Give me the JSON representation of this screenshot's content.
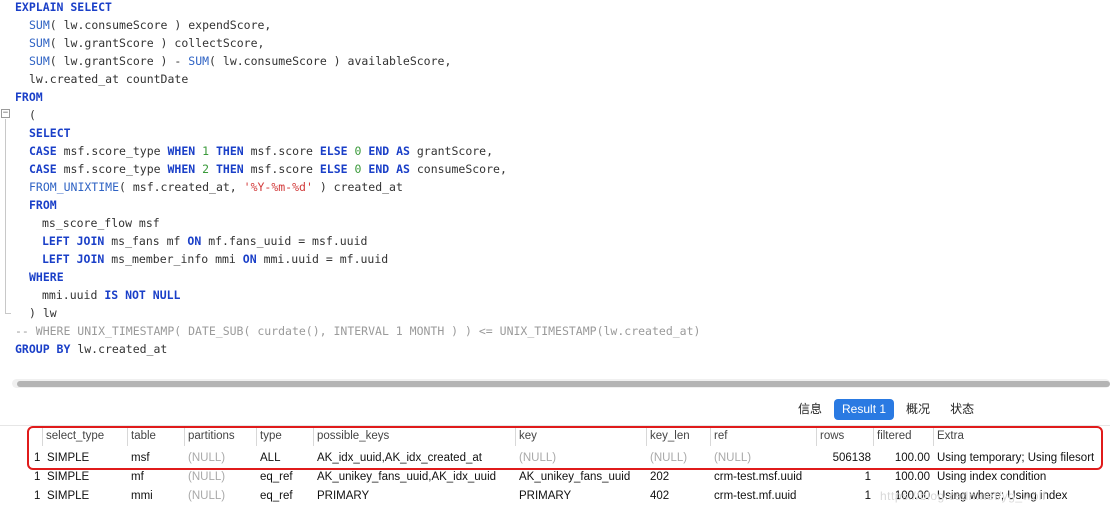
{
  "sql": {
    "l1": "EXPLAIN SELECT",
    "sum": "SUM",
    "l2_a": "( lw.consumeScore ) expendScore,",
    "l3_a": "( lw.grantScore ) collectScore,",
    "l4_a": "( lw.grantScore ) - ",
    "l4_b": "( lw.consumeScore ) availableScore,",
    "l5": "lw.created_at countDate",
    "from": "FROM",
    "paren_open": "(",
    "select": "SELECT",
    "case": "CASE",
    "l8_a": " msf.score_type ",
    "when": "WHEN",
    "then": "THEN",
    "else": "ELSE",
    "end_as": "END AS",
    "l8_num": "1",
    "l9_num": "2",
    "zero": "0",
    "l8_b": " msf.score ",
    "l8_c": " grantScore,",
    "l9_c": " consumeScore,",
    "from_unixtime": "FROM_UNIXTIME",
    "l10_a": "( msf.created_at, ",
    "l10_str": "'%Y-%m-%d'",
    "l10_b": " ) created_at",
    "l12": "ms_score_flow msf",
    "left_join": "LEFT JOIN",
    "l13_a": " ms_fans mf ",
    "on": "ON",
    "l13_b": " mf.fans_uuid = msf.uuid",
    "l14_a": " ms_member_info mmi ",
    "l14_b": " mmi.uuid = mf.uuid",
    "where": "WHERE",
    "l16_a": "mmi.uuid ",
    "is_not_null": "IS NOT NULL",
    "l17": ") lw",
    "comment": "-- WHERE UNIX_TIMESTAMP( DATE_SUB( curdate(), INTERVAL 1 MONTH ) ) <= UNIX_TIMESTAMP(lw.created_at)",
    "group_by": "GROUP BY",
    "l19": " lw.created_at"
  },
  "fold": {
    "minus": "−"
  },
  "tabs": [
    {
      "label": "信息",
      "active": false
    },
    {
      "label": "Result 1",
      "active": true
    },
    {
      "label": "概况",
      "active": false
    },
    {
      "label": "状态",
      "active": false
    }
  ],
  "columns": [
    "select_type",
    "table",
    "partitions",
    "type",
    "possible_keys",
    "key",
    "key_len",
    "ref",
    "rows",
    "filtered",
    "Extra"
  ],
  "rows": [
    {
      "id": "1",
      "select_type": "SIMPLE",
      "table": "msf",
      "partitions": "(NULL)",
      "type": "ALL",
      "possible_keys": "AK_idx_uuid,AK_idx_created_at",
      "key": "(NULL)",
      "key_len": "(NULL)",
      "ref": "(NULL)",
      "rows": "506138",
      "filtered": "100.00",
      "extra": "Using temporary; Using filesort"
    },
    {
      "id": "1",
      "select_type": "SIMPLE",
      "table": "mf",
      "partitions": "(NULL)",
      "type": "eq_ref",
      "possible_keys": "AK_unikey_fans_uuid,AK_idx_uuid",
      "key": "AK_unikey_fans_uuid",
      "key_len": "202",
      "ref": "crm-test.msf.uuid",
      "rows": "1",
      "filtered": "100.00",
      "extra": "Using index condition"
    },
    {
      "id": "1",
      "select_type": "SIMPLE",
      "table": "mmi",
      "partitions": "(NULL)",
      "type": "eq_ref",
      "possible_keys": "PRIMARY",
      "key": "PRIMARY",
      "key_len": "402",
      "ref": "crm-test.mf.uuid",
      "rows": "1",
      "filtered": "100.00",
      "extra": "Using where; Using index"
    }
  ],
  "watermark": "https://blog.csdn.net/yg_wolf",
  "colors": {
    "keyword": "#1a3fc8",
    "number": "#3a9a3a",
    "string": "#d23a3a",
    "accent": "#2a7ae2",
    "highlight": "#e01b1b"
  }
}
